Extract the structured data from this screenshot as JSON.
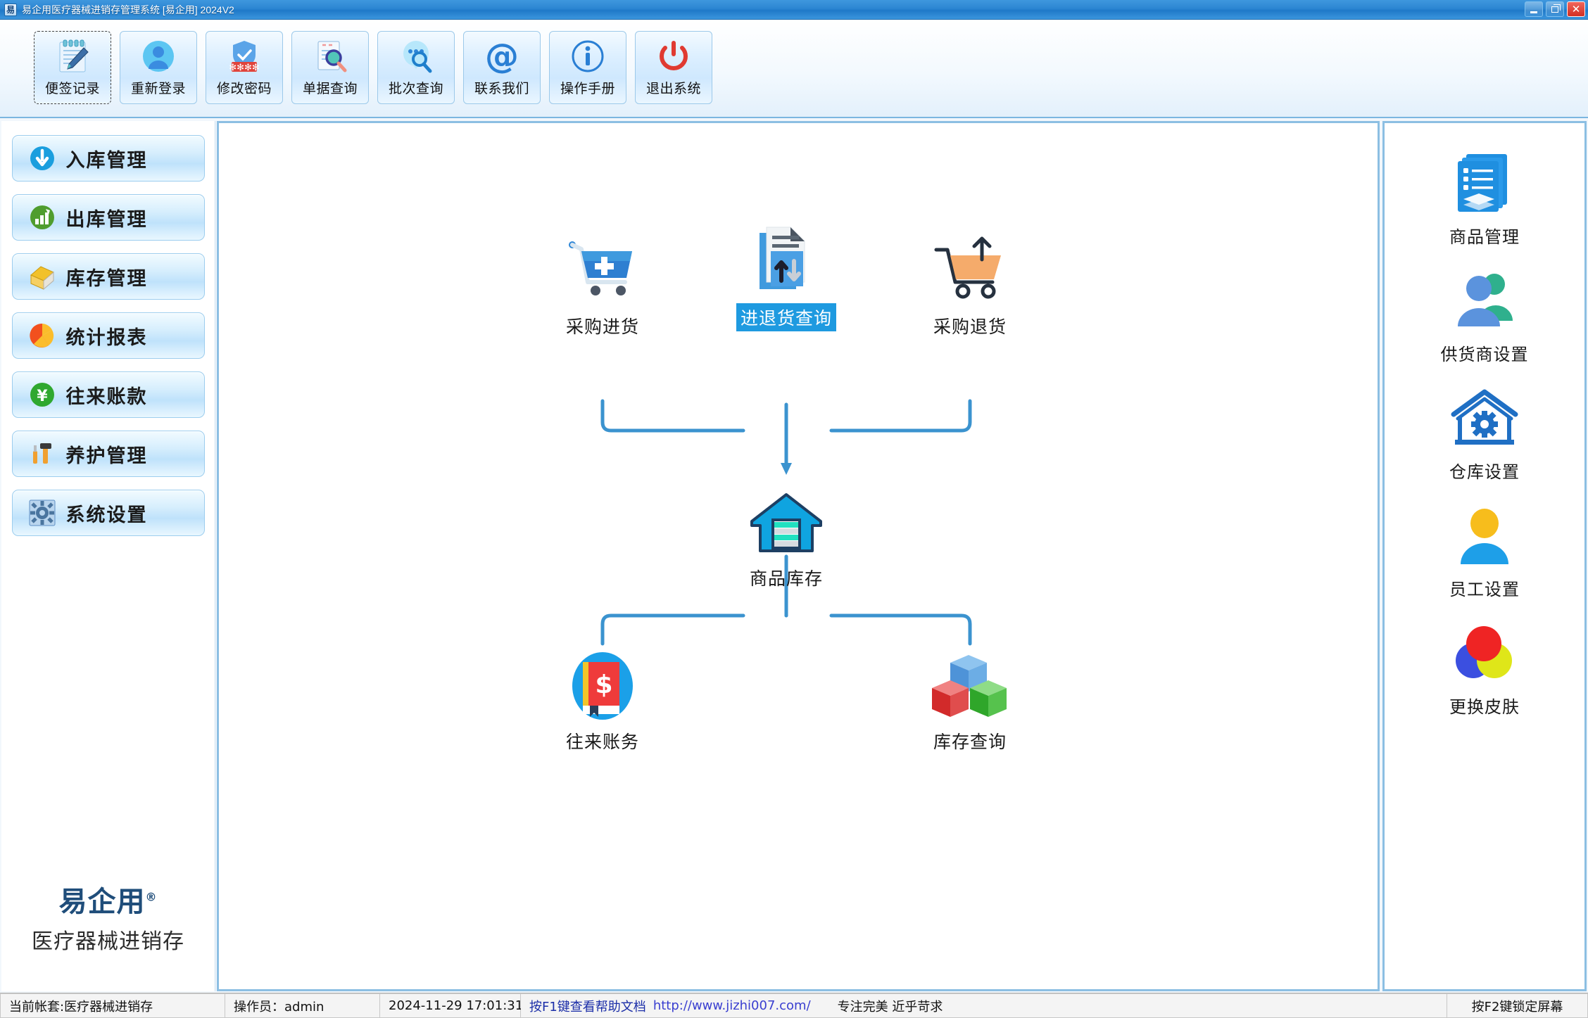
{
  "window": {
    "title": "易企用医疗器械进销存管理系统 [易企用] 2024V2",
    "icon_glyph": "易",
    "icon_name": "app-icon",
    "controls": [
      {
        "name": "minimize-button",
        "label": "最小化"
      },
      {
        "name": "restore-button",
        "label": "还原"
      },
      {
        "name": "close-button",
        "label": "✕"
      }
    ],
    "accent_color": "#2c86d2",
    "close_color": "#d12e22"
  },
  "toolbar": {
    "items": [
      {
        "label": "便签记录",
        "icon": "notepad-pen-icon",
        "selected": true
      },
      {
        "label": "重新登录",
        "icon": "user-avatar-icon",
        "selected": false
      },
      {
        "label": "修改密码",
        "icon": "shield-password-icon",
        "selected": false
      },
      {
        "label": "单据查询",
        "icon": "document-search-icon",
        "selected": false
      },
      {
        "label": "批次查询",
        "icon": "chat-search-icon",
        "selected": false
      },
      {
        "label": "联系我们",
        "icon": "at-sign-icon",
        "selected": false
      },
      {
        "label": "操作手册",
        "icon": "info-icon",
        "selected": false
      },
      {
        "label": "退出系统",
        "icon": "power-icon",
        "selected": false
      }
    ]
  },
  "sidebar": {
    "items": [
      {
        "label": "入库管理",
        "icon": "arrow-down-circle-icon",
        "color": "#1a9ede"
      },
      {
        "label": "出库管理",
        "icon": "bar-chart-circle-icon",
        "color": "#4f9d2e"
      },
      {
        "label": "库存管理",
        "icon": "warehouse-house-icon",
        "color": "#f2c12a"
      },
      {
        "label": "统计报表",
        "icon": "pie-chart-icon",
        "color": "#f25a22"
      },
      {
        "label": "往来账款",
        "icon": "yuan-circle-icon",
        "color": "#2fa82f"
      },
      {
        "label": "养护管理",
        "icon": "tools-icon",
        "color": "#e98e22"
      },
      {
        "label": "系统设置",
        "icon": "gear-icon",
        "color": "#5f8fc4"
      }
    ],
    "brand": {
      "name": "易企用",
      "registered_mark": "®",
      "subtitle": "医疗器械进销存"
    }
  },
  "flow": {
    "nodes": [
      {
        "id": "purchase-in",
        "label": "采购进货",
        "icon": "cart-plus-icon",
        "selected": false
      },
      {
        "id": "in-out-query",
        "label": "进退货查询",
        "icon": "document-updown-arrows-icon",
        "selected": true
      },
      {
        "id": "purchase-return",
        "label": "采购退货",
        "icon": "cart-up-arrow-icon",
        "selected": false
      },
      {
        "id": "goods-stock",
        "label": "商品库存",
        "icon": "warehouse-icon",
        "selected": false
      },
      {
        "id": "account-books",
        "label": "往来账务",
        "icon": "account-book-icon",
        "selected": false
      },
      {
        "id": "stock-query",
        "label": "库存查询",
        "icon": "cubes-icon",
        "selected": false
      }
    ],
    "line_color": "#3b93cf"
  },
  "right_panel": {
    "items": [
      {
        "label": "商品管理",
        "icon": "documents-stack-icon"
      },
      {
        "label": "供货商设置",
        "icon": "two-users-icon"
      },
      {
        "label": "仓库设置",
        "icon": "warehouse-gear-icon"
      },
      {
        "label": "员工设置",
        "icon": "single-user-icon"
      },
      {
        "label": "更换皮肤",
        "icon": "color-circles-icon"
      }
    ]
  },
  "statusbar": {
    "account": "当前帐套:医疗器械进销存",
    "operator": "操作员：admin",
    "datetime": "2024-11-29 17:01:31",
    "help_text": "按F1键查看帮助文档",
    "help_url": "http://www.jizhi007.com/",
    "slogan": "专注完美 近乎苛求",
    "lock_hint": "按F2键锁定屏幕"
  }
}
